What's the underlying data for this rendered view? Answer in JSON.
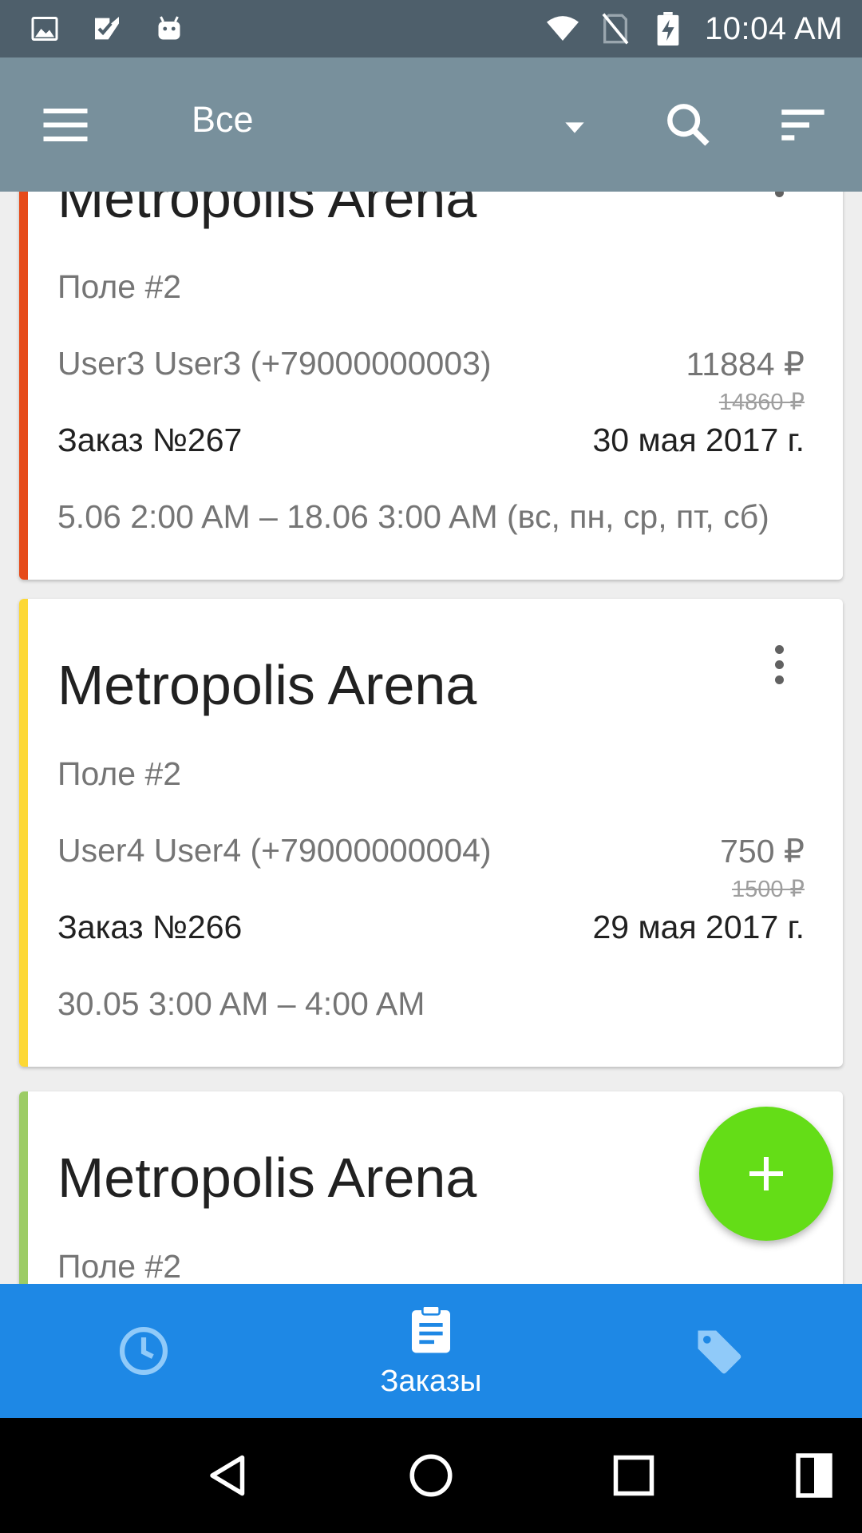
{
  "status_bar": {
    "time": "10:04 AM",
    "icons": [
      "image-icon",
      "check-app-icon",
      "android-icon",
      "wifi-icon",
      "no-sim-icon",
      "battery-charging-icon"
    ]
  },
  "toolbar": {
    "filter_label": "Все",
    "icons": [
      "menu-icon",
      "dropdown-arrow-icon",
      "search-icon",
      "sort-icon"
    ]
  },
  "cards": [
    {
      "title": "Metropolis Arena",
      "field": "Поле #2",
      "user": "User3 User3 (+79000000003)",
      "price": "11884 ₽",
      "old_price": "14860 ₽",
      "order": "Заказ №267",
      "date": "30 мая 2017 г.",
      "period": "5.06 2:00 AM – 18.06 3:00 AM (вс, пн, ср, пт, сб)",
      "stripe_color": "#e64a19"
    },
    {
      "title": "Metropolis Arena",
      "field": "Поле #2",
      "user": "User4 User4 (+79000000004)",
      "price": "750 ₽",
      "old_price": "1500 ₽",
      "order": "Заказ №266",
      "date": "29 мая 2017 г.",
      "period": "30.05 3:00 AM – 4:00 AM",
      "stripe_color": "#fdd835"
    },
    {
      "title": "Metropolis Arena",
      "field": "Поле #2",
      "stripe_color": "#9ccc65"
    }
  ],
  "fab": {
    "icon": "plus-icon",
    "color": "#64dd17"
  },
  "bottom_nav": {
    "items": [
      {
        "icon": "clock-icon",
        "label": ""
      },
      {
        "icon": "clipboard-icon",
        "label": "Заказы",
        "active": true
      },
      {
        "icon": "tag-icon",
        "label": ""
      }
    ],
    "color": "#1e88e5"
  },
  "system_nav": {
    "icons": [
      "back-icon",
      "home-icon",
      "recents-icon",
      "split-screen-icon"
    ]
  }
}
